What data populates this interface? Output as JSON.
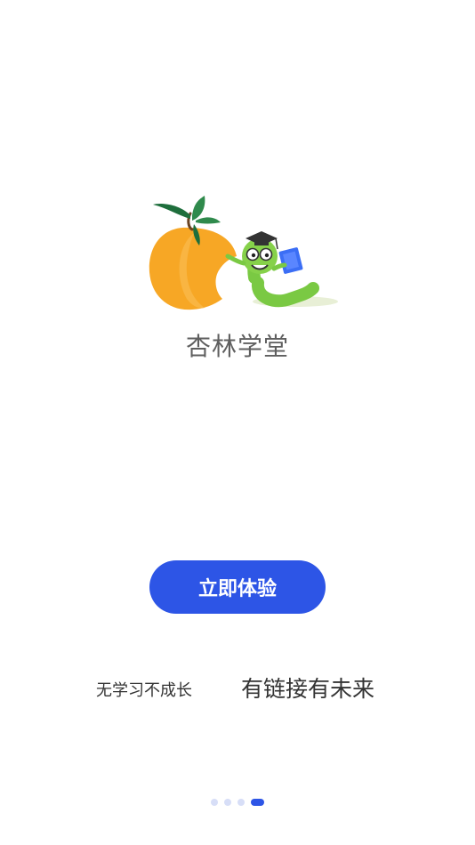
{
  "app": {
    "name": "杏林学堂"
  },
  "actions": {
    "start_label": "立即体验"
  },
  "slogans": {
    "left": "无学习不成长",
    "right": "有链接有未来"
  },
  "pager": {
    "total": 4,
    "active_index": 3
  },
  "colors": {
    "accent": "#2d55e6",
    "dot_inactive": "#d7def7",
    "apricot": "#f6a623",
    "worm": "#7ac943"
  }
}
